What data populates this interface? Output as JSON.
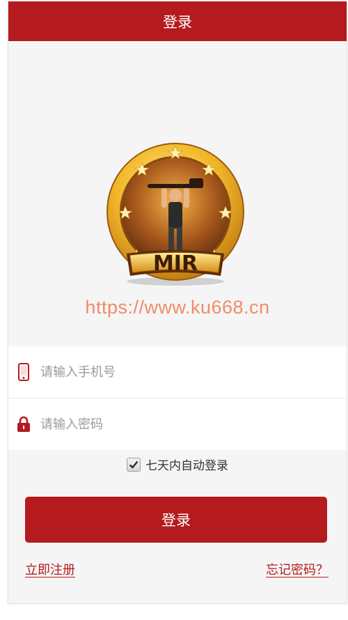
{
  "header": {
    "title": "登录"
  },
  "logo": {
    "text": "MIR"
  },
  "watermark": "https://www.ku668.cn",
  "form": {
    "phone": {
      "placeholder": "请输入手机号",
      "icon": "phone-icon"
    },
    "password": {
      "placeholder": "请输入密码",
      "icon": "lock-icon"
    }
  },
  "remember": {
    "label": "七天内自动登录",
    "checked": true
  },
  "actions": {
    "login_label": "登录",
    "register_label": "立即注册",
    "forgot_label": "忘记密码？"
  },
  "colors": {
    "brand": "#b51b1e",
    "watermark": "#f08a6a",
    "background": "#f5f5f5"
  }
}
